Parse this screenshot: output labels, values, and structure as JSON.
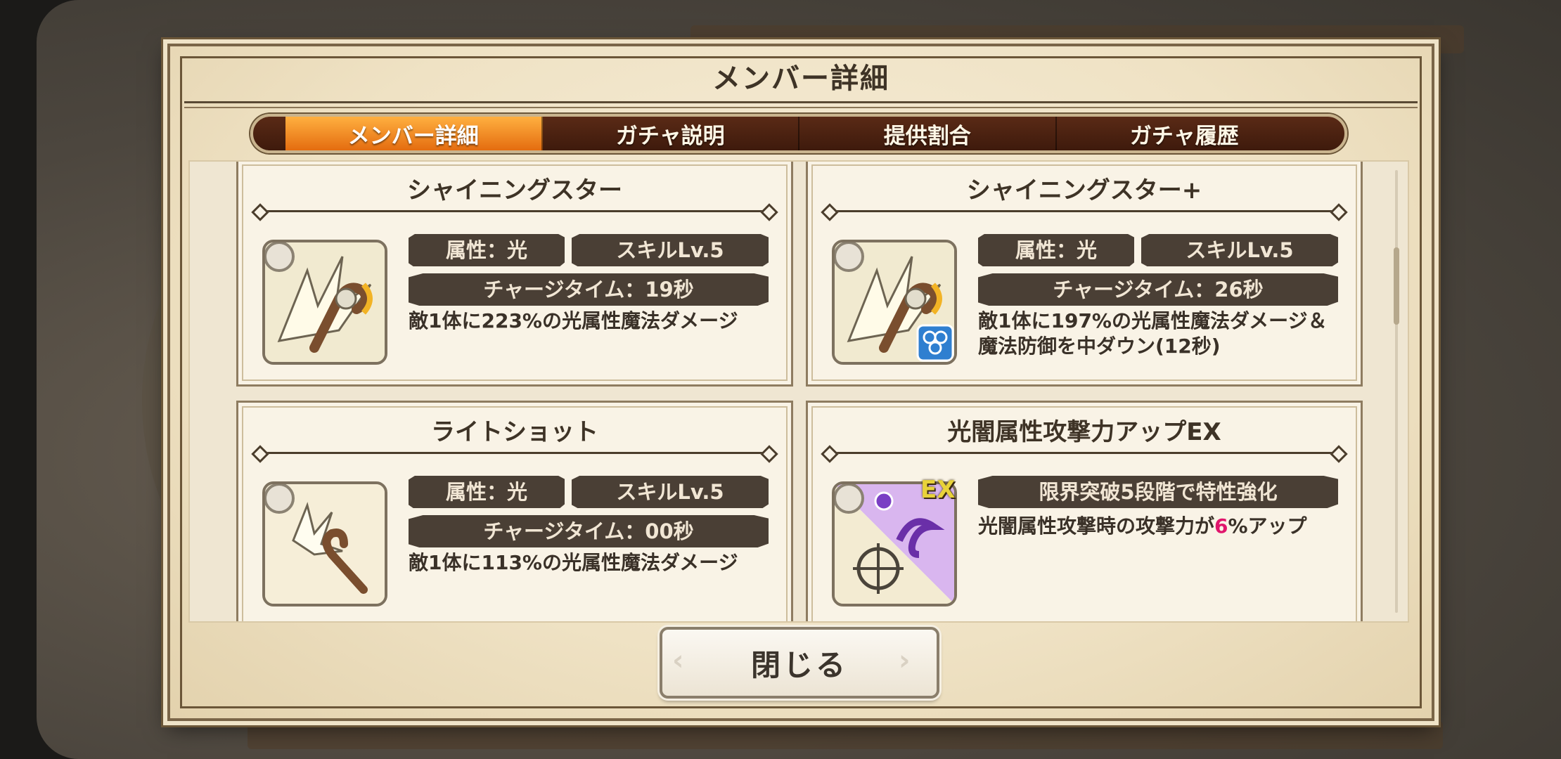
{
  "modal": {
    "title": "メンバー詳細",
    "close_label": "閉じる"
  },
  "tabs": [
    {
      "label": "メンバー詳細",
      "active": true
    },
    {
      "label": "ガチャ説明",
      "active": false
    },
    {
      "label": "提供割合",
      "active": false
    },
    {
      "label": "ガチャ履歴",
      "active": false
    }
  ],
  "cards": [
    {
      "title": "シャイニングスター",
      "attribute": "属性：光",
      "skill_level": "スキルLv.5",
      "charge_time": "チャージタイム：19秒",
      "description": "敵1体に223%の光属性魔法ダメージ",
      "icon": "staff-burst-icon"
    },
    {
      "title": "シャイニングスター+",
      "attribute": "属性：光",
      "skill_level": "スキルLv.5",
      "charge_time": "チャージタイム：26秒",
      "description": "敵1体に197%の光属性魔法ダメージ＆魔法防御を中ダウン(12秒)",
      "icon": "staff-burst-plus-icon"
    },
    {
      "title": "ライトショット",
      "attribute": "属性：光",
      "skill_level": "スキルLv.5",
      "charge_time": "チャージタイム：00秒",
      "description": "敵1体に113%の光属性魔法ダメージ",
      "icon": "staff-spark-icon"
    },
    {
      "title": "光闇属性攻撃力アップEX",
      "trait_note": "限界突破5段階で特性強化",
      "description_pre": "光闇属性攻撃時の攻撃力が",
      "description_value": "6",
      "description_post": "%アップ",
      "badge": "EX",
      "icon": "light-dark-attack-up-icon"
    }
  ],
  "colors": {
    "tab_active": "#f08a20",
    "tab_bar": "#4a1f0f",
    "stat_bg": "#4a3f35",
    "accent": "#e0156c"
  }
}
